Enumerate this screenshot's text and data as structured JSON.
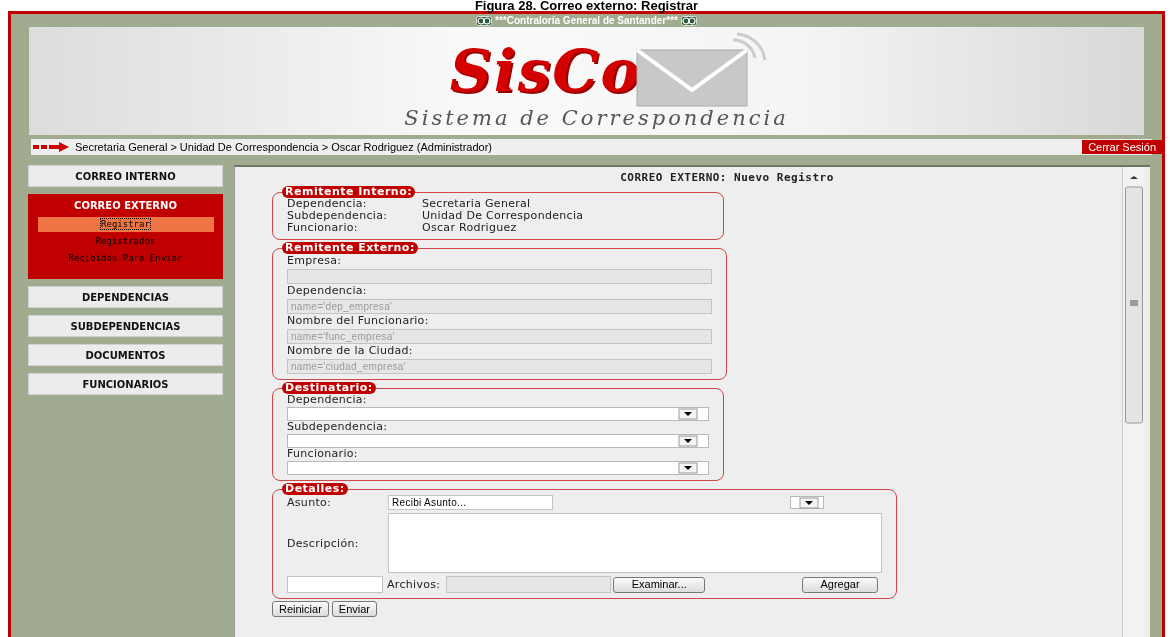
{
  "caption": "Figura 28. Correo externo: Registrar",
  "header": {
    "title": "***Contraloría General de Santander***",
    "logo": "SisCo",
    "subtitle": "Sistema de Correspondencia"
  },
  "breadcrumb": "Secretaria General > Unidad De Correspondencia > Oscar Rodriguez (Administrador)",
  "logout": "Cerrar Sesión",
  "sidebar": [
    {
      "label": "CORREO INTERNO",
      "expanded": false
    },
    {
      "label": "CORREO EXTERNO",
      "expanded": true,
      "children": [
        {
          "label": "Registrar",
          "selected": true
        },
        {
          "label": "Registrados",
          "selected": false
        },
        {
          "label": "Recibidos Para Enviar",
          "selected": false
        }
      ]
    },
    {
      "label": "DEPENDENCIAS",
      "expanded": false
    },
    {
      "label": "SUBDEPENDENCIAS",
      "expanded": false
    },
    {
      "label": "DOCUMENTOS",
      "expanded": false
    },
    {
      "label": "FUNCIONARIOS",
      "expanded": false
    }
  ],
  "form": {
    "title": "CORREO EXTERNO: Nuevo Registro",
    "sections": [
      {
        "kind": "info",
        "legend": "Remitente Interno:",
        "rows": [
          {
            "label": "Dependencia:",
            "value": "Secretaria General"
          },
          {
            "label": "Subdependencia:",
            "value": "Unidad De Correspondencia"
          },
          {
            "label": "Funcionario:",
            "value": "Oscar Rodriguez"
          }
        ]
      },
      {
        "kind": "inputs",
        "legend": "Remitente Externo:",
        "fields": [
          {
            "label": "Empresa:",
            "disabled": true
          },
          {
            "label": "Dependencia:",
            "placeholder": "name='dep_empresa'",
            "disabled": true
          },
          {
            "label": "Nombre del Funcionario:",
            "placeholder": "name='func_empresa'",
            "disabled": true
          },
          {
            "label": "Nombre de la Ciudad:",
            "placeholder": "name='ciudad_empresa'",
            "disabled": true
          }
        ]
      },
      {
        "kind": "selects",
        "legend": "Destinatario:",
        "fields": [
          {
            "label": "Dependencia:"
          },
          {
            "label": "Subdependencia:"
          },
          {
            "label": "Funcionario:"
          }
        ]
      },
      {
        "kind": "details",
        "legend": "Detalles:",
        "subject_label": "Asunto:",
        "subject_value": "Recibi Asunto...",
        "description_label": "Descripción:",
        "files_label": "Archivos:",
        "browse": "Examinar...",
        "add": "Agregar"
      }
    ],
    "buttons": [
      "Reiniciar",
      "Enviar"
    ]
  }
}
